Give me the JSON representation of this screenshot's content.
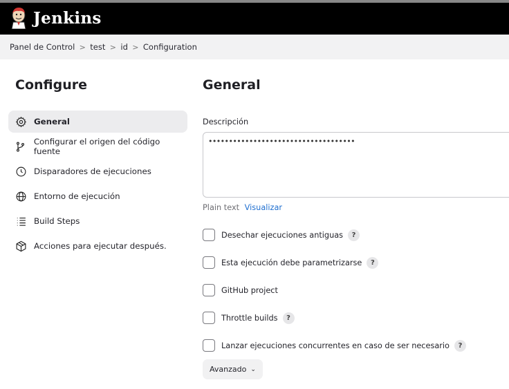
{
  "header": {
    "app_name": "Jenkins",
    "background": "#000000"
  },
  "breadcrumb": [
    "Panel de Control",
    "test",
    "id",
    "Configuration"
  ],
  "sidebar": {
    "title": "Configure",
    "items": [
      {
        "label": "General",
        "icon": "gear-icon",
        "active": true
      },
      {
        "label": "Configurar el origen del código fuente",
        "icon": "source-branch-icon"
      },
      {
        "label": "Disparadores de ejecuciones",
        "icon": "clock-icon"
      },
      {
        "label": "Entorno de ejecución",
        "icon": "globe-icon"
      },
      {
        "label": "Build Steps",
        "icon": "list-icon"
      },
      {
        "label": "Acciones para ejecutar después.",
        "icon": "package-icon"
      }
    ]
  },
  "main": {
    "title": "General",
    "description": {
      "label": "Descripción",
      "value": "••••••••••••••••••••••••••••••••••••",
      "format_plain": "Plain text",
      "format_preview": "Visualizar"
    },
    "options": [
      {
        "label": "Desechar ejecuciones antiguas",
        "checked": false,
        "help": true
      },
      {
        "label": "Esta ejecución debe parametrizarse",
        "checked": false,
        "help": true
      },
      {
        "label": "GitHub project",
        "checked": false,
        "help": false
      },
      {
        "label": "Throttle builds",
        "checked": false,
        "help": true
      },
      {
        "label": "Lanzar ejecuciones concurrentes en caso de ser necesario",
        "checked": false,
        "help": true
      }
    ],
    "help_symbol": "?",
    "advanced_label": "Avanzado",
    "accent_link": "#1f6fd0"
  }
}
